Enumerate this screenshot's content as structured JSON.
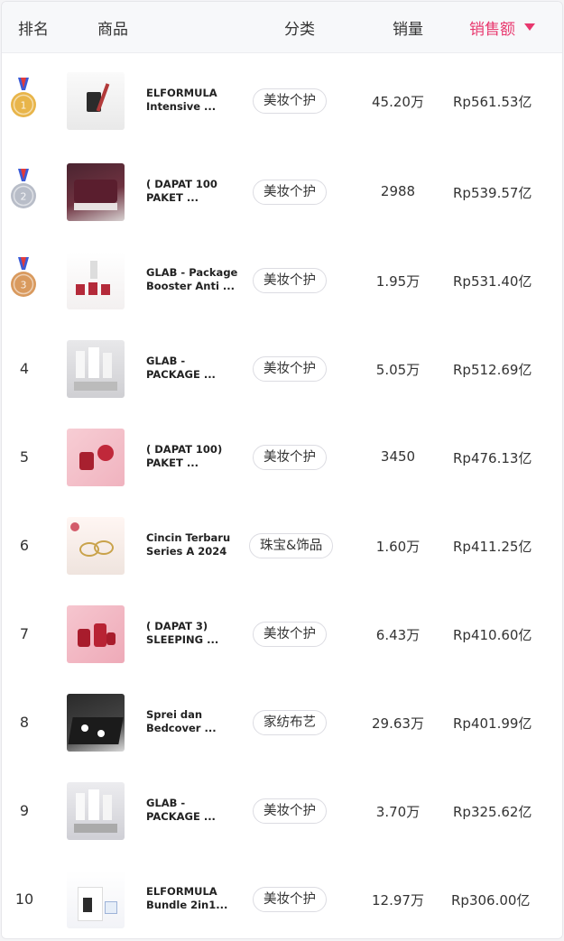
{
  "header": {
    "rank": "排名",
    "product": "商品",
    "category": "分类",
    "sales": "销量",
    "revenue": "销售额"
  },
  "rows": [
    {
      "rank": "1",
      "medal": "gold",
      "name1": "ELFORMULA",
      "name2": "Intensive ...",
      "category": "美妆个护",
      "sales": "45.20万",
      "revenue": "Rp561.53亿"
    },
    {
      "rank": "2",
      "medal": "silver",
      "name1": "( DAPAT 100",
      "name2": "PAKET ...",
      "category": "美妆个护",
      "sales": "2988",
      "revenue": "Rp539.57亿"
    },
    {
      "rank": "3",
      "medal": "bronze",
      "name1": "GLAB - Package",
      "name2": "Booster Anti ...",
      "category": "美妆个护",
      "sales": "1.95万",
      "revenue": "Rp531.40亿"
    },
    {
      "rank": "4",
      "medal": "",
      "name1": "GLAB -",
      "name2": "PACKAGE ...",
      "category": "美妆个护",
      "sales": "5.05万",
      "revenue": "Rp512.69亿"
    },
    {
      "rank": "5",
      "medal": "",
      "name1": "( DAPAT 100)",
      "name2": "PAKET ...",
      "category": "美妆个护",
      "sales": "3450",
      "revenue": "Rp476.13亿"
    },
    {
      "rank": "6",
      "medal": "",
      "name1": "Cincin Terbaru",
      "name2": "Series A 2024",
      "category": "珠宝&饰品",
      "sales": "1.60万",
      "revenue": "Rp411.25亿"
    },
    {
      "rank": "7",
      "medal": "",
      "name1": "( DAPAT 3)",
      "name2": "SLEEPING ...",
      "category": "美妆个护",
      "sales": "6.43万",
      "revenue": "Rp410.60亿"
    },
    {
      "rank": "8",
      "medal": "",
      "name1": "Sprei dan",
      "name2": "Bedcover ...",
      "category": "家纺布艺",
      "sales": "29.63万",
      "revenue": "Rp401.99亿"
    },
    {
      "rank": "9",
      "medal": "",
      "name1": "GLAB -",
      "name2": "PACKAGE ...",
      "category": "美妆个护",
      "sales": "3.70万",
      "revenue": "Rp325.62亿"
    },
    {
      "rank": "10",
      "medal": "",
      "name1": "ELFORMULA",
      "name2": "Bundle 2in1...",
      "category": "美妆个护",
      "sales": "12.97万",
      "revenue": "Rp306.00亿"
    }
  ],
  "colors": {
    "accent": "#e8386e",
    "gold": "#e8b54a",
    "silver": "#b8bdc8",
    "bronze": "#d99a5e"
  },
  "icons": {
    "sort": "caret-down-icon",
    "medal": "medal-icon"
  }
}
